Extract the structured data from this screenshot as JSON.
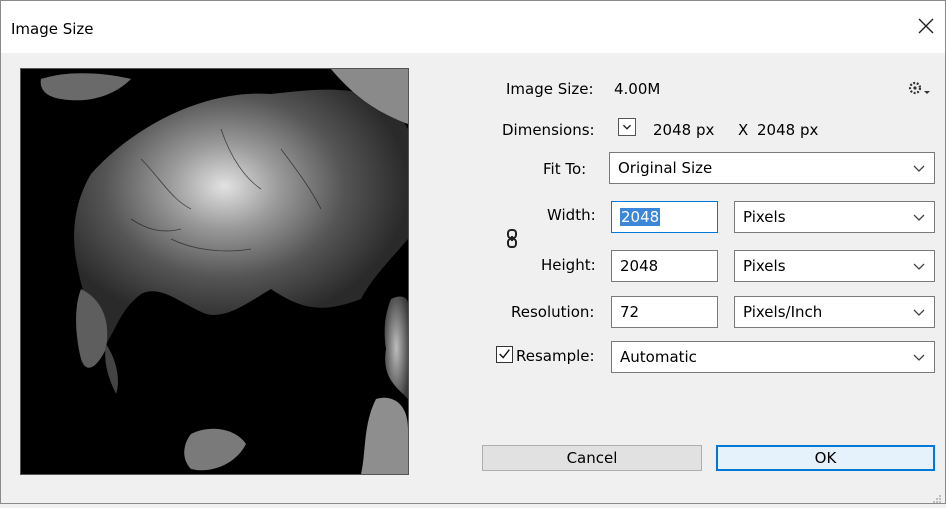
{
  "window": {
    "title": "Image Size"
  },
  "info": {
    "image_size_label": "Image Size:",
    "image_size_value": "4.00M",
    "dimensions_label": "Dimensions:",
    "dim_width": "2048 px",
    "dim_sep": "X",
    "dim_height": "2048 px"
  },
  "fit_to": {
    "label": "Fit To:",
    "value": "Original Size"
  },
  "width": {
    "label": "Width:",
    "value": "2048",
    "unit": "Pixels"
  },
  "height": {
    "label": "Height:",
    "value": "2048",
    "unit": "Pixels"
  },
  "resolution": {
    "label": "Resolution:",
    "value": "72",
    "unit": "Pixels/Inch"
  },
  "resample": {
    "label": "Resample:",
    "checked": true,
    "value": "Automatic"
  },
  "buttons": {
    "cancel": "Cancel",
    "ok": "OK"
  },
  "icons": {
    "close": "close-icon",
    "gear": "gear-icon",
    "link": "link-chain-icon",
    "dimensions_dropdown": "chevron-down-icon"
  },
  "colors": {
    "ok_border": "#0078d7",
    "selection": "#3b86d8"
  }
}
